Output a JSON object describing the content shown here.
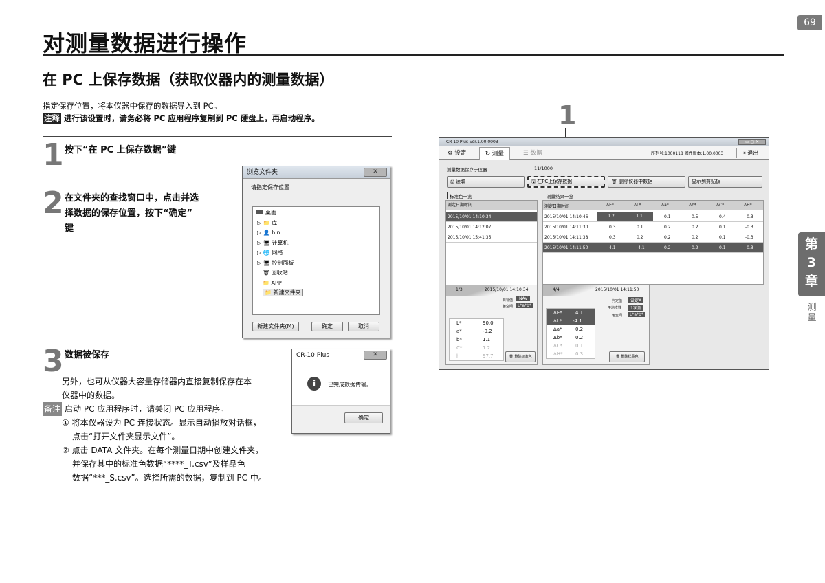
{
  "page_number": "69",
  "title": "对测量数据进行操作",
  "subtitle": "在 PC 上保存数据（获取仪器内的测量数据）",
  "intro": "指定保存位置，将本仪器中保存的数据导入到 PC。",
  "note": {
    "tag": "注释",
    "text": "进行该设置时，请务必将 PC 应用程序复制到 PC 硬盘上，再启动程序。"
  },
  "steps": [
    {
      "num": "1",
      "text": "按下“在 PC 上保存数据”键"
    },
    {
      "num": "2",
      "text_lines": [
        "在文件夹的查找窗口中，点击并选",
        "择数据的保存位置，按下“确定”",
        "键"
      ]
    },
    {
      "num": "3",
      "text": "数据被保存"
    }
  ],
  "body": {
    "lines": [
      "另外，也可从仪器大容量存储器内直接复制保存在本",
      "仪器中的数据。"
    ],
    "remark_tag": "备注",
    "remark": "启动 PC 应用程序时，请关闭 PC 应用程序。",
    "item1": [
      "① 将本仪器设为 PC 连接状态。显示自动播放对话框，",
      "点击“打开文件夹显示文件”。"
    ],
    "item2": [
      "② 点击 DATA 文件夹。在每个测量日期中创建文件夹，",
      "并保存其中的标准色数据“****_T.csv”及样品色",
      "数据“***_S.csv”。选择所需的数据，复制到 PC 中。"
    ]
  },
  "browse_dialog": {
    "title": "浏览文件夹",
    "prompt": "请指定保存位置",
    "tree": [
      "桌面",
      "库",
      "hin",
      "计算机",
      "网络",
      "控制面板",
      "回收站",
      "APP",
      "新建文件夹"
    ],
    "new_folder_btn": "新建文件夹(M)",
    "ok_btn": "确定",
    "cancel_btn": "取消"
  },
  "done_dialog": {
    "title": "CR-10 Plus",
    "message": "已完成数据传输。",
    "ok_btn": "确定"
  },
  "callout": "1",
  "software": {
    "title": "CR-10 Plus Ver.1.00.0003",
    "tabs": [
      "设定",
      "测量",
      "数据"
    ],
    "serial": "序列号:1000118   固件版本:1.00.0003",
    "exit": "退出",
    "storage_label": "测量数据保存于仪器",
    "storage_count": "11/1000",
    "read_btn": "读取",
    "save_pc_btn": "在PC上保存数据",
    "delete_btn": "删除仪器中数据",
    "print_btn": "显示到剪贴板",
    "std_list_label": "标准色一览",
    "std_header": "测定日期时间",
    "std_rows": [
      "2015/10/01 14:10:34",
      "2015/10/01 14:12:07",
      "2015/10/01 15:41:35"
    ],
    "res_list_label": "测量结果一览",
    "res_headers": [
      "测定日期时间",
      "ΔE*",
      "ΔL*",
      "Δa*",
      "Δb*",
      "ΔC*",
      "ΔH*"
    ],
    "res_rows": [
      [
        "2015/10/01 14:10:46",
        "1.2",
        "1.1",
        "0.1",
        "0.5",
        "0.4",
        "-0.3"
      ],
      [
        "2015/10/01 14:11:30",
        "0.3",
        "0.1",
        "0.2",
        "0.2",
        "0.1",
        "-0.3"
      ],
      [
        "2015/10/01 14:11:38",
        "0.3",
        "0.2",
        "0.2",
        "0.2",
        "0.1",
        "-0.3"
      ],
      [
        "2015/10/01 14:11:50",
        "4.1",
        "-4.1",
        "0.2",
        "0.2",
        "0.1",
        "-0.3"
      ]
    ],
    "std_detail": {
      "index": "1/3",
      "datetime": "2015/10/01 14:10:34",
      "labels": [
        "目标值",
        "色空间"
      ],
      "badges": [
        "NAV",
        "L*a*b*"
      ],
      "rows": [
        [
          "L*",
          "90.0"
        ],
        [
          "a*",
          "-0.2"
        ],
        [
          "b*",
          "1.1"
        ],
        [
          "C*",
          "1.2"
        ],
        [
          "h",
          "97.7"
        ]
      ],
      "delete_btn": "删除标准色"
    },
    "res_detail": {
      "index": "4/4",
      "datetime": "2015/10/01 14:11:50",
      "labels": [
        "判定值",
        "平均次数",
        "色空间"
      ],
      "badges": [
        "设定A",
        "1次测",
        "L*a*b*"
      ],
      "rows": [
        [
          "ΔE*",
          "4.1"
        ],
        [
          "ΔL*",
          "-4.1"
        ],
        [
          "Δa*",
          "0.2"
        ],
        [
          "Δb*",
          "0.2"
        ],
        [
          "ΔC*",
          "0.1"
        ],
        [
          "ΔH*",
          "0.3"
        ]
      ],
      "delete_btn": "删除样品色"
    }
  },
  "chapter": {
    "line1": "第",
    "line2": "3",
    "line3": "章",
    "label1": "测",
    "label2": "量"
  }
}
